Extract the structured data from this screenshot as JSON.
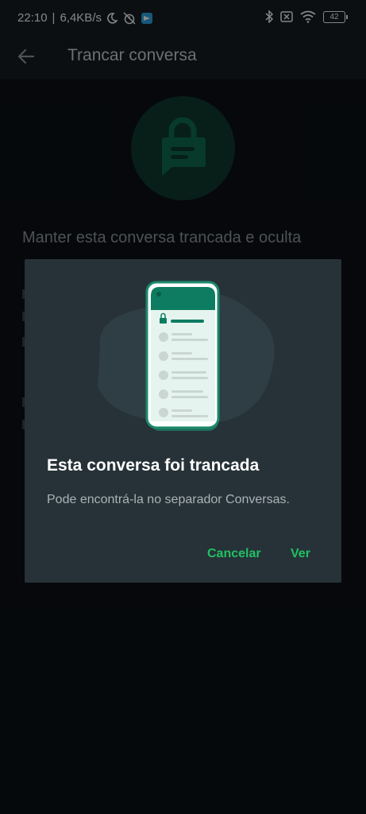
{
  "status_bar": {
    "time": "22:10",
    "speed": "6,4KB/s",
    "battery": "42"
  },
  "header": {
    "title": "Trancar conversa"
  },
  "main": {
    "heading": "Manter esta conversa trancada e oculta"
  },
  "dialog": {
    "title": "Esta conversa foi trancada",
    "body": "Pode encontrá-la no separador Conversas.",
    "cancel_label": "Cancelar",
    "view_label": "Ver"
  },
  "colors": {
    "accent": "#21c063",
    "dialog_bg": "#263238",
    "background": "#0b1014"
  },
  "icons": [
    "back-arrow-icon",
    "lock-chat-icon",
    "moon-icon",
    "alarm-off-icon",
    "telegram-icon",
    "bluetooth-icon",
    "no-sim-icon",
    "wifi-icon",
    "battery-icon"
  ]
}
